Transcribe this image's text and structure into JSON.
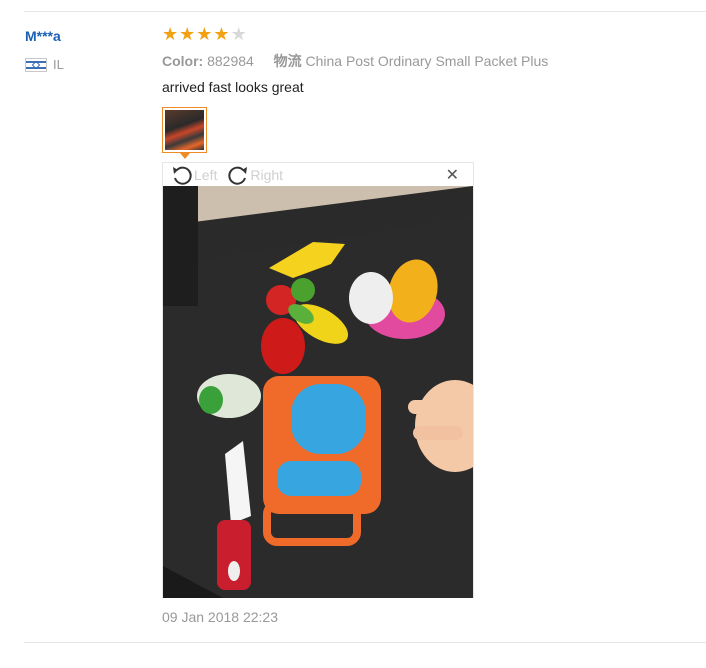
{
  "review": {
    "user_name": "M***a",
    "country_code": "IL",
    "rating": 4,
    "rating_max": 5,
    "color_label": "Color:",
    "color_value": "882984",
    "shipping_label": "物流",
    "shipping_value": "China Post Ordinary Small Packet Plus",
    "text": "arrived fast looks great",
    "date": "09 Jan 2018 22:23"
  },
  "viewer": {
    "rotate_left_label": "Left",
    "rotate_right_label": "Right",
    "close_glyph": "✕"
  },
  "icons": {
    "star": "star-icon",
    "rotate_left": "rotate-left-icon",
    "rotate_right": "rotate-right-icon",
    "close": "close-icon",
    "flag": "israel-flag-icon"
  },
  "colors": {
    "user_name": "#1a5fb4",
    "star_filled": "#f2a113",
    "star_empty": "#d8d8d8",
    "thumb_border": "#f08a24"
  }
}
